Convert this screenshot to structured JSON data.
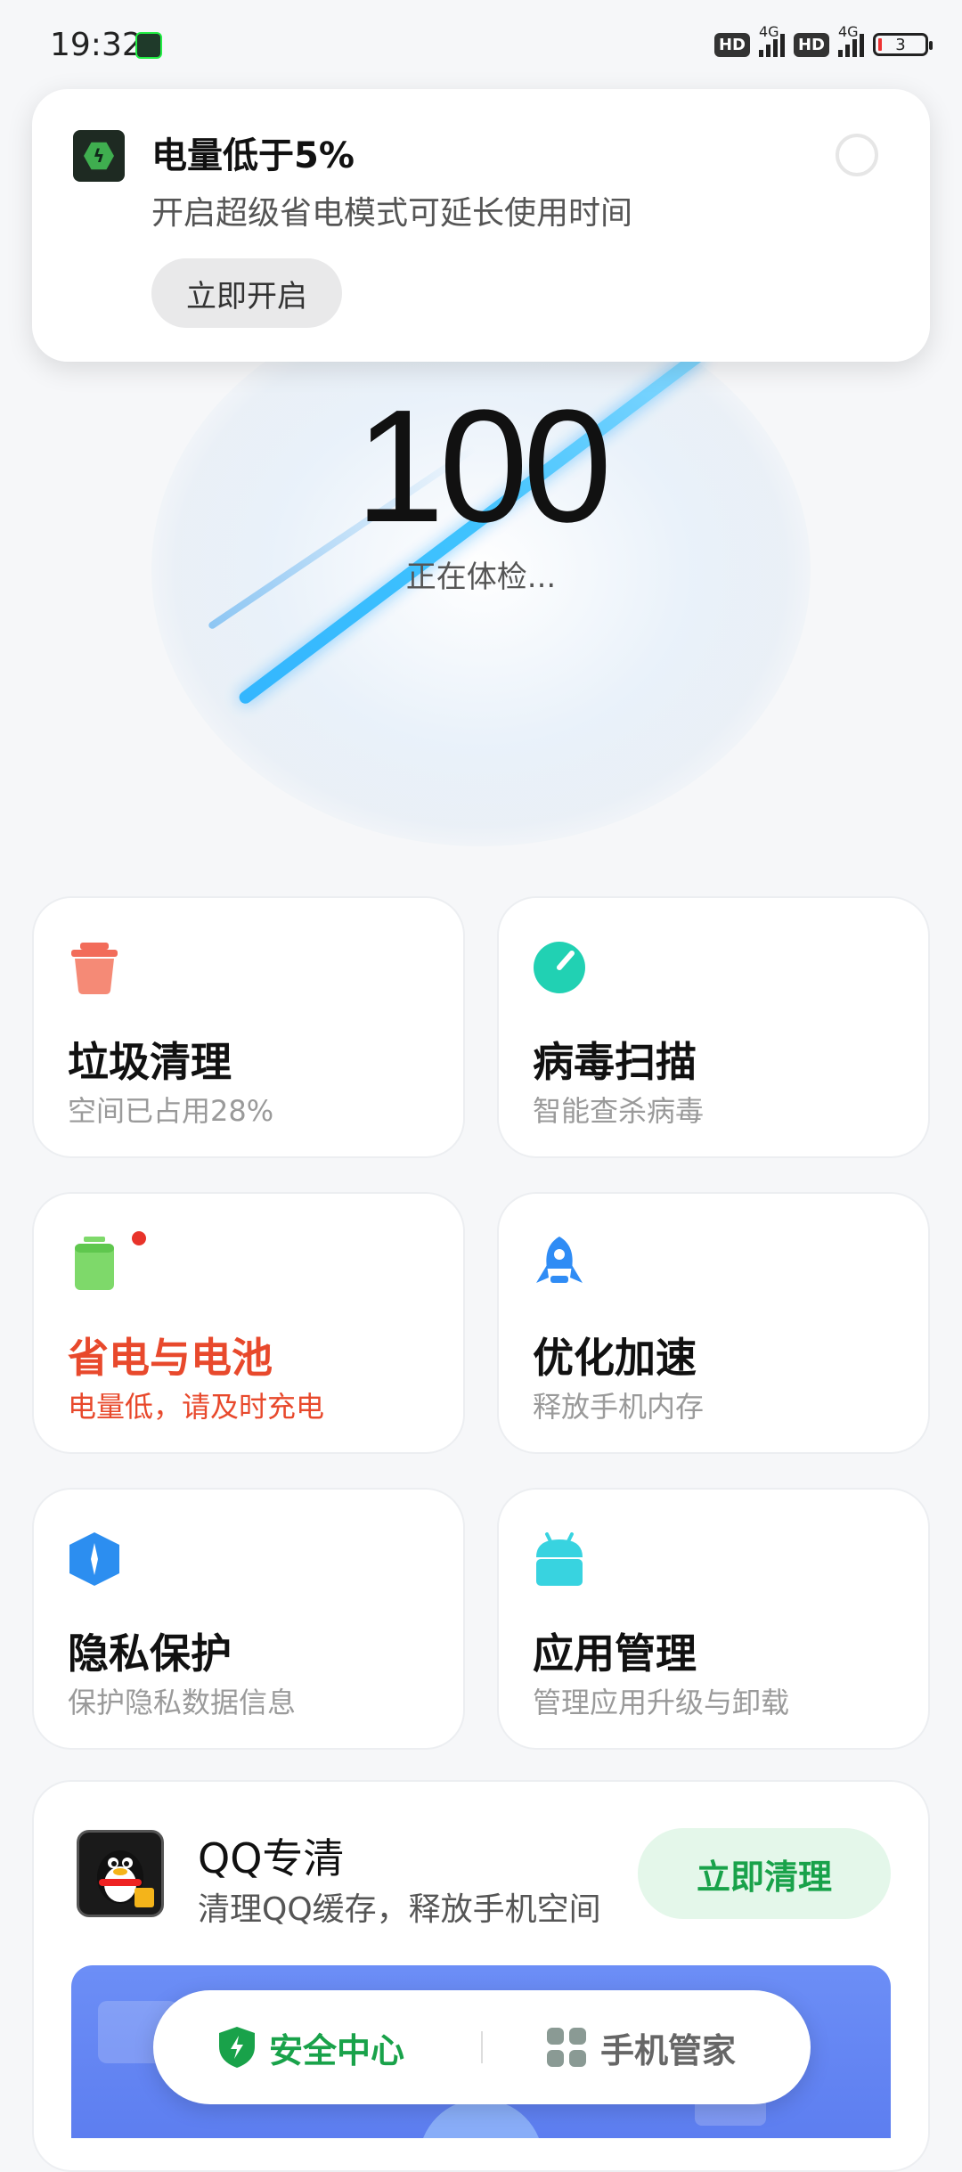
{
  "status_bar": {
    "time": "19:32",
    "hd1": "HD",
    "net1": "4G",
    "hd2": "HD",
    "net2": "4G",
    "battery_level": "3"
  },
  "notification": {
    "title": "电量低于5%",
    "body": "开启超级省电模式可延长使用时间",
    "button": "立即开启"
  },
  "hero": {
    "score": "100",
    "status": "正在体检..."
  },
  "cards": [
    {
      "title": "垃圾清理",
      "subtitle": "空间已占用28%",
      "icon": "trash-icon",
      "color": "#f26c5a"
    },
    {
      "title": "病毒扫描",
      "subtitle": "智能查杀病毒",
      "icon": "scan-icon",
      "color": "#21d1b3"
    },
    {
      "title": "省电与电池",
      "subtitle": "电量低，请及时充电",
      "icon": "battery-icon",
      "color": "#7ed96a",
      "alert_color": "#e8492c"
    },
    {
      "title": "优化加速",
      "subtitle": "释放手机内存",
      "icon": "rocket-icon",
      "color": "#2f8cf5"
    },
    {
      "title": "隐私保护",
      "subtitle": "保护隐私数据信息",
      "icon": "privacy-icon",
      "color": "#2c8ef0"
    },
    {
      "title": "应用管理",
      "subtitle": "管理应用升级与卸载",
      "icon": "android-icon",
      "color": "#38d3e0"
    }
  ],
  "qq_clean": {
    "title": "QQ专清",
    "subtitle": "清理QQ缓存，释放手机空间",
    "button": "立即清理"
  },
  "bottom_nav": {
    "security": "安全中心",
    "manager": "手机管家",
    "active_color": "#19a24a"
  }
}
